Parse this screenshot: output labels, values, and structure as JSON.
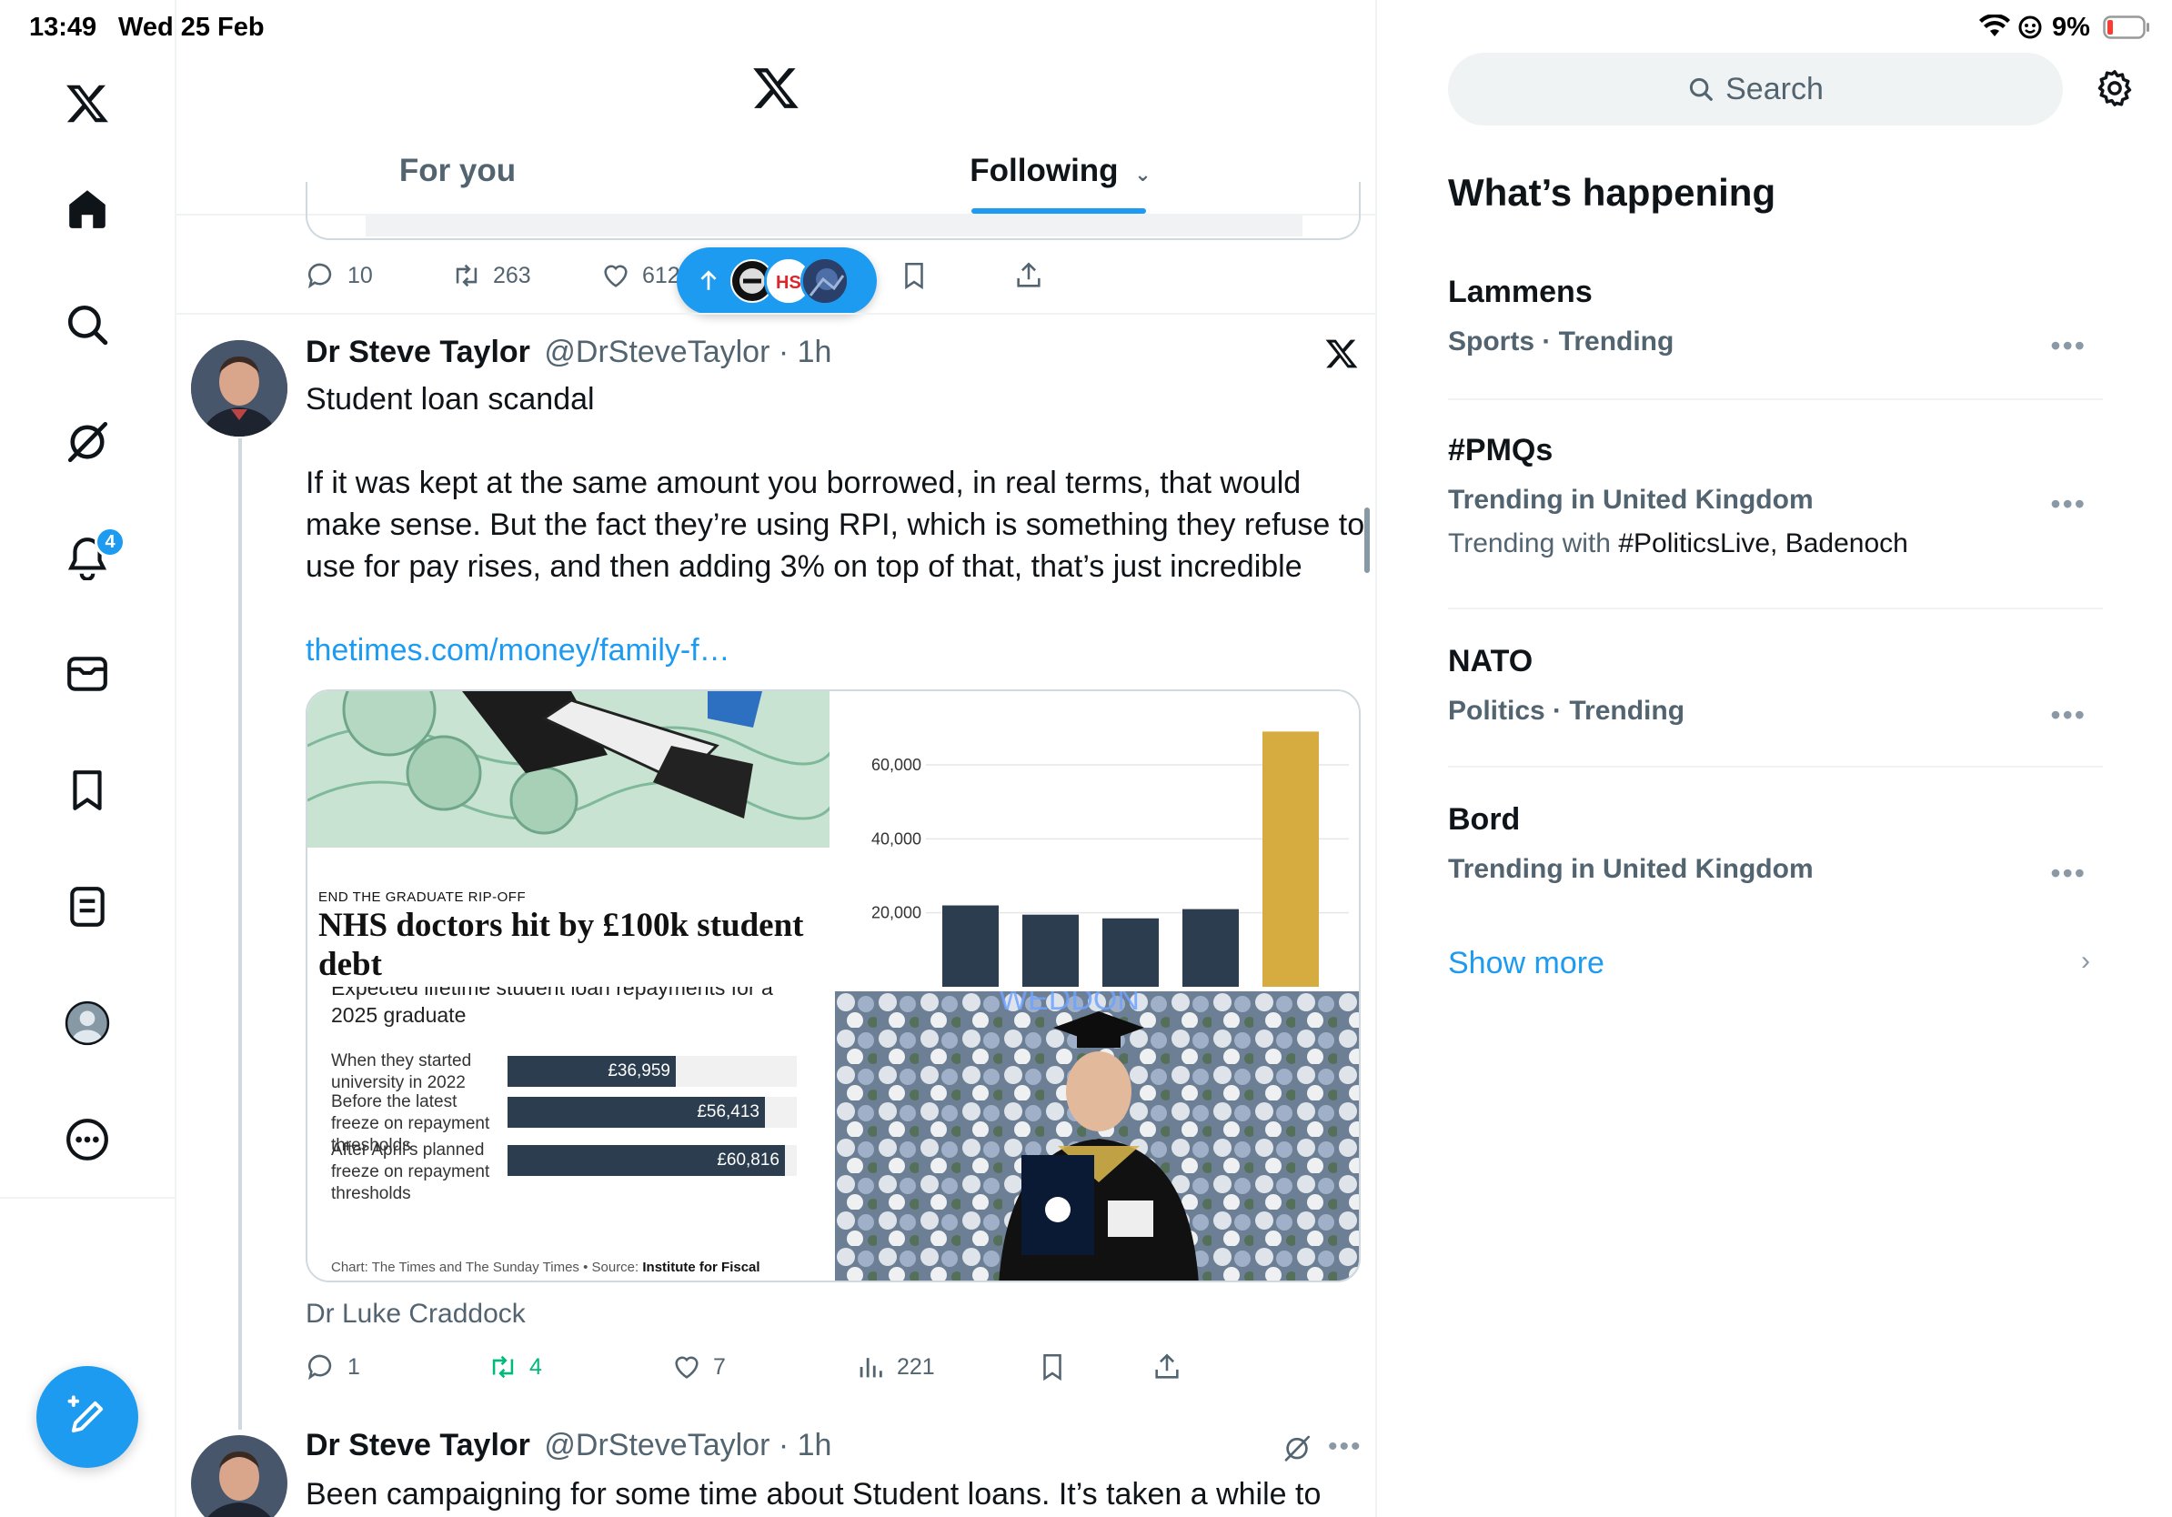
{
  "status": {
    "time": "13:49",
    "date": "Wed 25 Feb",
    "battery": "9%"
  },
  "nav": {
    "items": [
      {
        "icon": "x-logo-icon"
      },
      {
        "icon": "home-icon"
      },
      {
        "icon": "search-icon"
      },
      {
        "icon": "grok-icon"
      },
      {
        "icon": "bell-icon",
        "badge": "4"
      },
      {
        "icon": "mail-icon"
      },
      {
        "icon": "bookmark-icon"
      },
      {
        "icon": "list-icon"
      },
      {
        "icon": "profile-icon"
      },
      {
        "icon": "more-icon"
      }
    ]
  },
  "header": {
    "tabs": [
      {
        "label": "For you"
      },
      {
        "label": "Following"
      }
    ]
  },
  "prev_tweet": {
    "replies": "10",
    "reposts": "263",
    "likes": "612"
  },
  "tweet1": {
    "name": "Dr Steve Taylor",
    "handle": "@DrSteveTaylor",
    "time": "1h",
    "title": "Student loan scandal",
    "body": "If it was kept at the same amount you borrowed, in real terms, that would make sense. But the fact they’re using RPI, which is something they refuse to use for pay rises, and then adding 3% on top of that, that’s just incredible",
    "link": "thetimes.com/money/family-f…",
    "card": {
      "kicker": "END THE GRADUATE RIP-OFF",
      "headline": "NHS doctors hit by £100k student debt",
      "subhead_partial": "Expected lifetime student loan repayments for a",
      "subhead": "2025 graduate",
      "rows": [
        {
          "label": "When they started university in 2022",
          "value": "£36,959",
          "amount": 36959
        },
        {
          "label": "Before the latest freeze on repayment thresholds",
          "value": "£56,413",
          "amount": 56413
        },
        {
          "label": "After April's planned freeze on repayment thresholds",
          "value": "£60,816",
          "amount": 60816
        }
      ],
      "footnote_prefix": "Chart: The Times and The Sunday Times • Source: ",
      "footnote_strong": "Institute for Fiscal",
      "photo_banner": "WEDDON"
    },
    "attribution": "Dr Luke Craddock",
    "stats": {
      "replies": "1",
      "reposts": "4",
      "likes": "7",
      "views": "221"
    }
  },
  "tweet2": {
    "name": "Dr Steve Taylor",
    "handle": "@DrSteveTaylor",
    "time": "1h",
    "body": "Been campaigning for some time about Student loans. It’s taken a while to"
  },
  "search": {
    "placeholder": "Search"
  },
  "sidebar": {
    "title": "What’s happening",
    "trends": [
      {
        "title": "Lammens",
        "meta": "Sports · Trending"
      },
      {
        "title": "#PMQs",
        "meta": "Trending in United Kingdom",
        "sub_prefix": "Trending with ",
        "sub_tags": "#PoliticsLive, Badenoch"
      },
      {
        "title": "NATO",
        "meta": "Politics · Trending"
      },
      {
        "title": "Bord",
        "meta": "Trending in United Kingdom"
      }
    ],
    "show_more": "Show more"
  },
  "colors": {
    "accent": "#1d9bf0",
    "repost_active": "#00ba7c",
    "bar_navy": "#2b3d4f",
    "bar_gold": "#d6ac40",
    "text_muted": "#536471"
  },
  "chart_data": [
    {
      "type": "bar",
      "categories": [
        "1",
        "2",
        "3",
        "4",
        "5"
      ],
      "values": [
        22000,
        19500,
        18500,
        21000,
        69000
      ],
      "ylabel": "",
      "tick_labels": [
        "60,000",
        "40,000",
        "20,000"
      ],
      "ylim": [
        0,
        75000
      ]
    },
    {
      "type": "bar",
      "orientation": "horizontal",
      "categories": [
        "When they started university in 2022",
        "Before the latest freeze on repayment thresholds",
        "After April's planned freeze on repayment thresholds"
      ],
      "values": [
        36959,
        56413,
        60816
      ]
    }
  ]
}
